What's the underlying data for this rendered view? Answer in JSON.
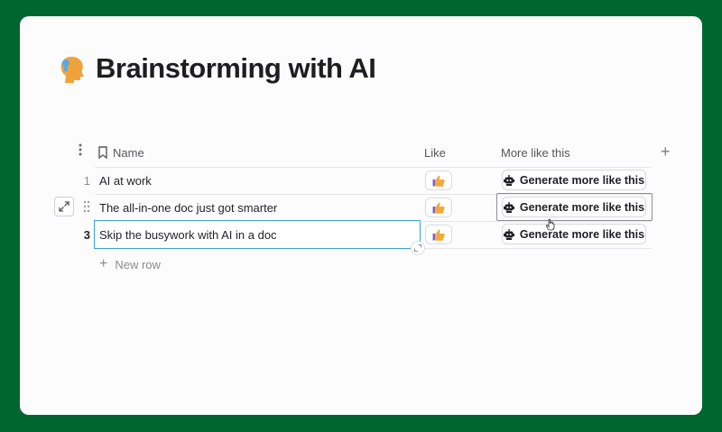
{
  "page": {
    "title": "Brainstorming with AI",
    "icon": "head-profile-icon"
  },
  "table": {
    "columns": {
      "name": "Name",
      "like": "Like",
      "more": "More like this"
    },
    "rows": [
      {
        "number": "1",
        "name": "AI at work",
        "button": "Generate more like this"
      },
      {
        "number": "",
        "name": "The all-in-one doc just got smarter",
        "button": "Generate more like this"
      },
      {
        "number": "3",
        "name": "Skip the busywork with AI in a doc",
        "button": "Generate more like this"
      }
    ],
    "new_row_label": "New row"
  },
  "colors": {
    "background": "#00662f",
    "card": "#fdfcfd",
    "edit_border": "#3ea3c9"
  }
}
